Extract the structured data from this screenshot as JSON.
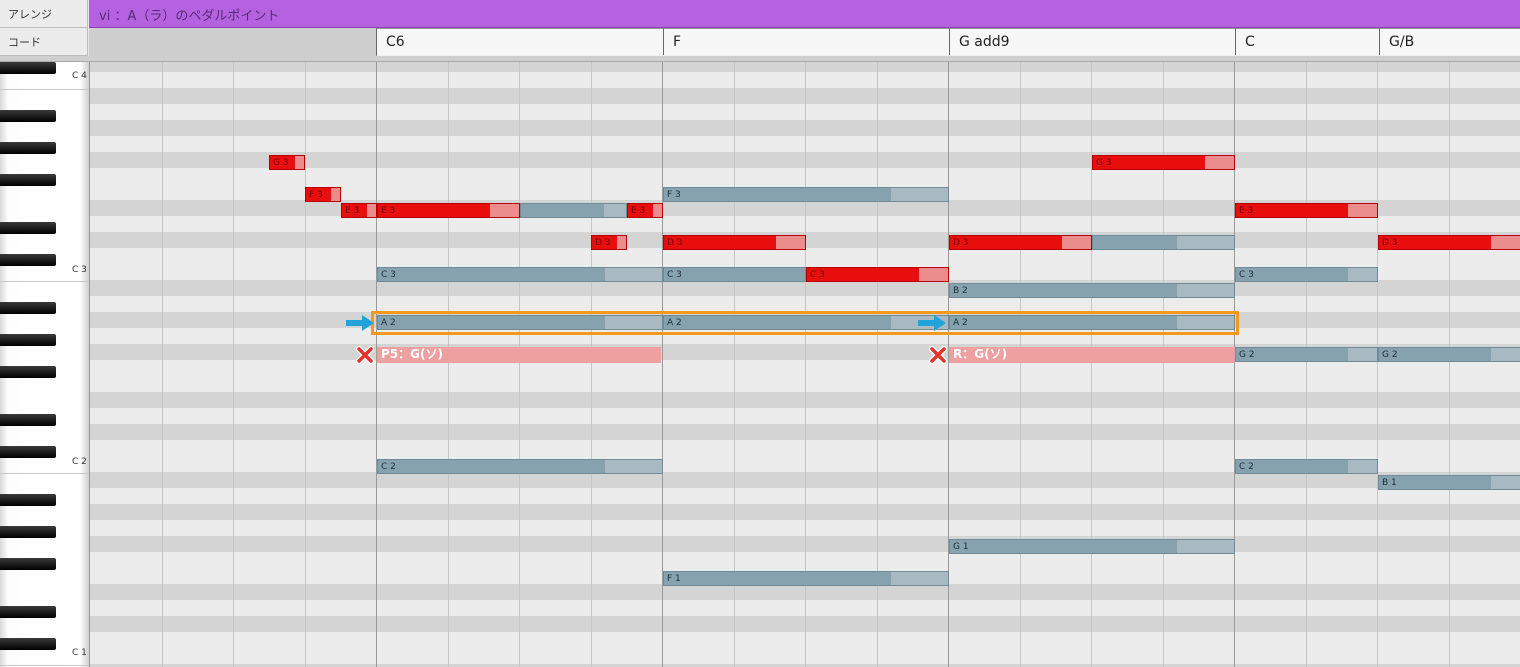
{
  "tracks": {
    "arrange_label": "アレンジ",
    "chord_label": "コード",
    "arrange_title": "vi ：A（ラ）のペダルポイント"
  },
  "chords": [
    "C6",
    "F",
    "G add9",
    "C",
    "G/B"
  ],
  "keyboard": {
    "octave_labels": [
      "C 4",
      "C 3",
      "C 2",
      "C 1"
    ]
  },
  "notes": {
    "G3_a": "G 3",
    "F3_a": "F 3",
    "E3_a": "E 3",
    "E3_b": "E 3",
    "E3_c": "E 3",
    "F3_b": "F 3",
    "G3_b": "G 3",
    "E3_d": "E 3",
    "D3_a": "D 3",
    "D3_b": "D 3",
    "D3_c": "D 3",
    "D3_d": "D 3",
    "C3_a": "C 3",
    "C3_b": "C 3",
    "C3_c": "C 3",
    "C3_d": "C 3",
    "B2": "B 2",
    "A2_a": "A 2",
    "A2_b": "A 2",
    "A2_c": "A 2",
    "G2_a": "G 2",
    "G2_b": "G 2",
    "C2_a": "C 2",
    "C2_b": "C 2",
    "B1": "B 1",
    "G1": "G 1",
    "F1": "F 1"
  },
  "markers": {
    "p5_label": "P5：G(ソ)",
    "r_label": "R：G(ソ)"
  },
  "colors": {
    "arrange_lane": "#b562e0",
    "note_red": "#e80e0e",
    "note_blue": "#86a2af",
    "highlight": "#f39a1e",
    "arrow": "#1fa3d8",
    "x_mark": "#e5322d"
  },
  "icons": {
    "arrow": "arrow-right-icon",
    "cross": "x-mark-icon"
  }
}
